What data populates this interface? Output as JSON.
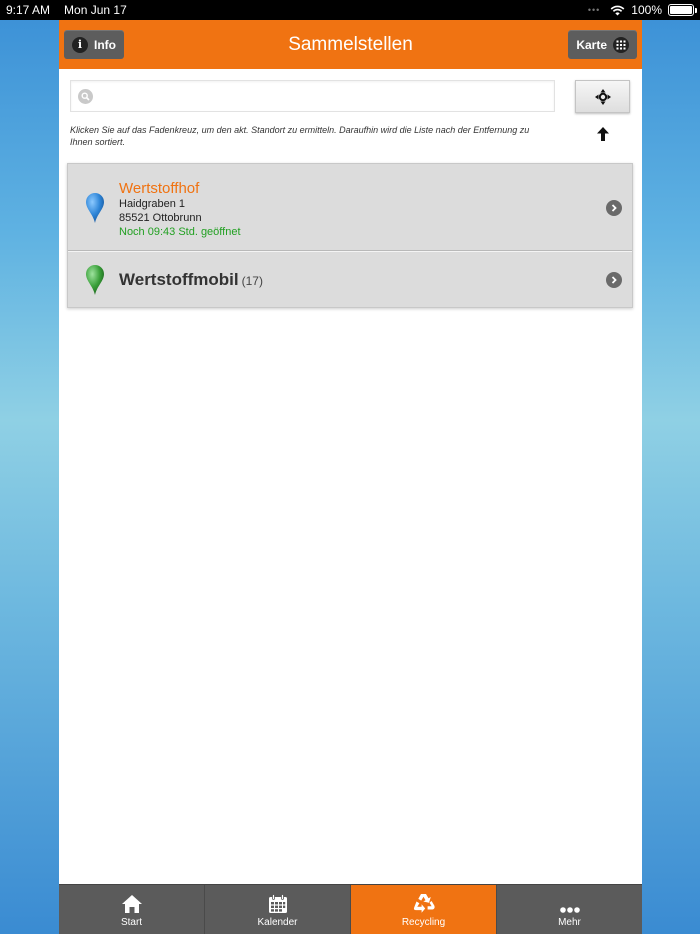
{
  "status": {
    "time": "9:17 AM",
    "date": "Mon Jun 17",
    "battery": "100%"
  },
  "navbar": {
    "title": "Sammelstellen",
    "info_label": "Info",
    "map_label": "Karte"
  },
  "search": {
    "value": "",
    "placeholder": ""
  },
  "hint": "Klicken Sie auf das Fadenkreuz, um den akt. Standort zu ermitteln. Daraufhin wird die Liste nach der Entfernung zu Ihnen sortiert.",
  "list": {
    "items": [
      {
        "name": "Wertstoffhof",
        "street": "Haidgraben 1",
        "city": "85521 Ottobrunn",
        "status": "Noch 09:43 Std. geöffnet",
        "pin_color": "#2f86d8"
      },
      {
        "name": "Wertstoffmobil",
        "count": "(17)",
        "pin_color": "#3aa03a"
      }
    ]
  },
  "tabs": [
    {
      "label": "Start",
      "icon": "home-icon"
    },
    {
      "label": "Kalender",
      "icon": "calendar-icon"
    },
    {
      "label": "Recycling",
      "icon": "recycle-icon",
      "active": true
    },
    {
      "label": "Mehr",
      "icon": "more-icon"
    }
  ],
  "colors": {
    "accent": "#f07312",
    "open_green": "#22a022",
    "tabbar": "#5b5b5b"
  }
}
